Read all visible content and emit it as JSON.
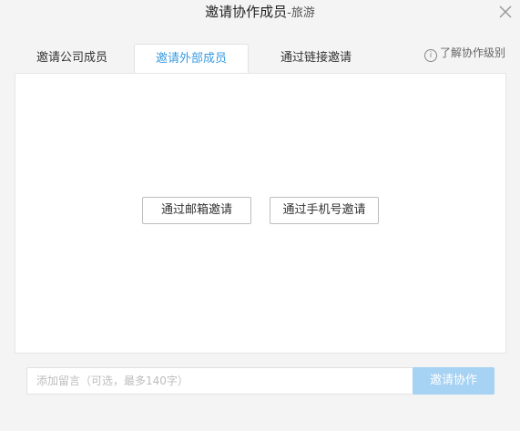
{
  "dialog": {
    "title": "邀请协作成员",
    "subtitle": "-旅游",
    "close_icon": "close-icon"
  },
  "tabs": [
    {
      "label": "邀请公司成员",
      "active": false
    },
    {
      "label": "邀请外部成员",
      "active": true
    },
    {
      "label": "通过链接邀请",
      "active": false
    }
  ],
  "help": {
    "icon": "info-icon",
    "label": "了解协作级别"
  },
  "invite_options": {
    "email_label": "通过邮箱邀请",
    "phone_label": "通过手机号邀请"
  },
  "footer": {
    "message_placeholder": "添加留言（可选，最多140字）",
    "submit_label": "邀请协作"
  },
  "colors": {
    "accent": "#3a9be0",
    "submit_disabled": "#a6d2f3"
  }
}
